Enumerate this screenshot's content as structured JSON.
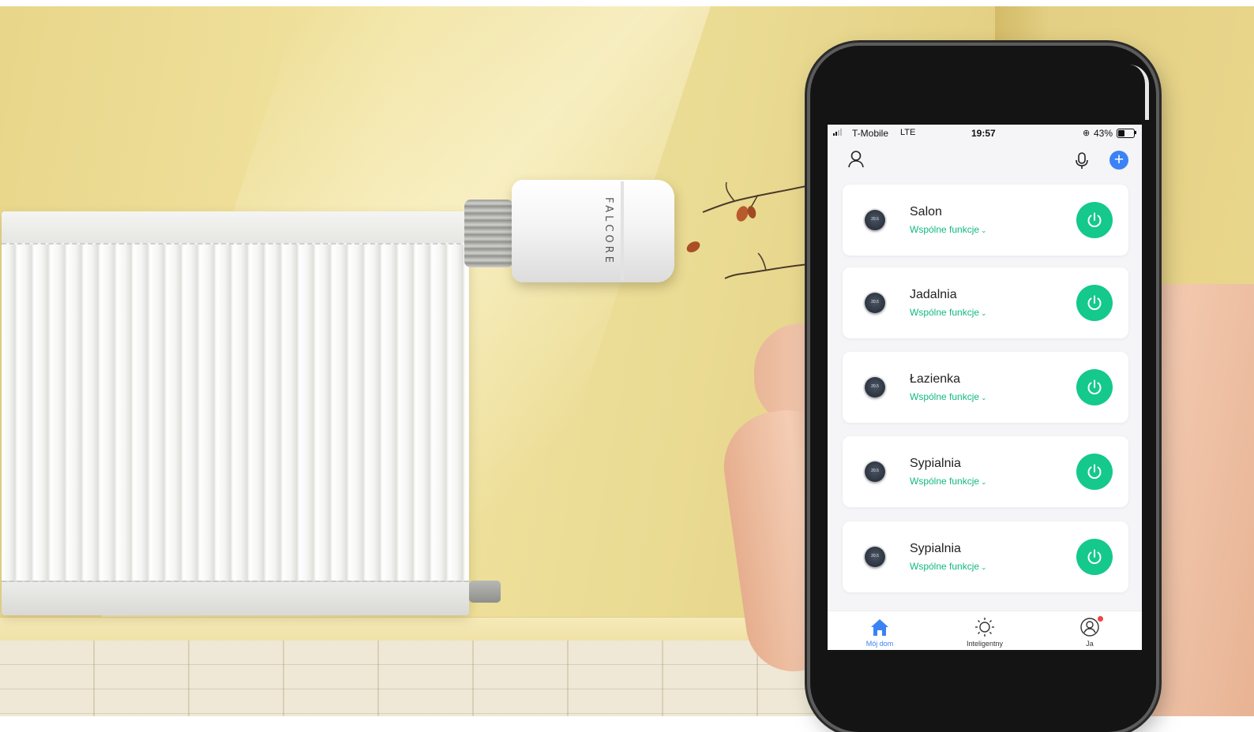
{
  "scene": {
    "thermostat_brand": "FALCORE"
  },
  "status_bar": {
    "carrier": "T-Mobile",
    "network": "LTE",
    "time": "19:57",
    "battery_percent": "43%",
    "battery_level": 0.43
  },
  "header": {
    "user_icon": "user-outline-icon",
    "mic_icon": "microphone-icon",
    "add_icon": "plus-circle-icon",
    "add_symbol": "+"
  },
  "devices": [
    {
      "name": "Salon",
      "subtitle": "Wspólne funkcje",
      "thumb_text": "20.5",
      "power": "on"
    },
    {
      "name": "Jadalnia",
      "subtitle": "Wspólne funkcje",
      "thumb_text": "20.5",
      "power": "on"
    },
    {
      "name": "Łazienka",
      "subtitle": "Wspólne funkcje",
      "thumb_text": "20.5",
      "power": "on"
    },
    {
      "name": "Sypialnia",
      "subtitle": "Wspólne funkcje",
      "thumb_text": "20.5",
      "power": "on"
    },
    {
      "name": "Sypialnia",
      "subtitle": "Wspólne funkcje",
      "thumb_text": "20.5",
      "power": "on"
    }
  ],
  "bottom_nav": {
    "items": [
      {
        "label": "Mój dom",
        "icon": "home-icon",
        "active": true
      },
      {
        "label": "Inteligentny",
        "icon": "sun-icon",
        "active": false
      },
      {
        "label": "Ja",
        "icon": "profile-icon",
        "active": false,
        "notification": true
      }
    ]
  },
  "colors": {
    "accent": "#3b82f6",
    "power_green": "#14c98b",
    "subtitle_green": "#10b981",
    "notification_red": "#ef4444"
  }
}
